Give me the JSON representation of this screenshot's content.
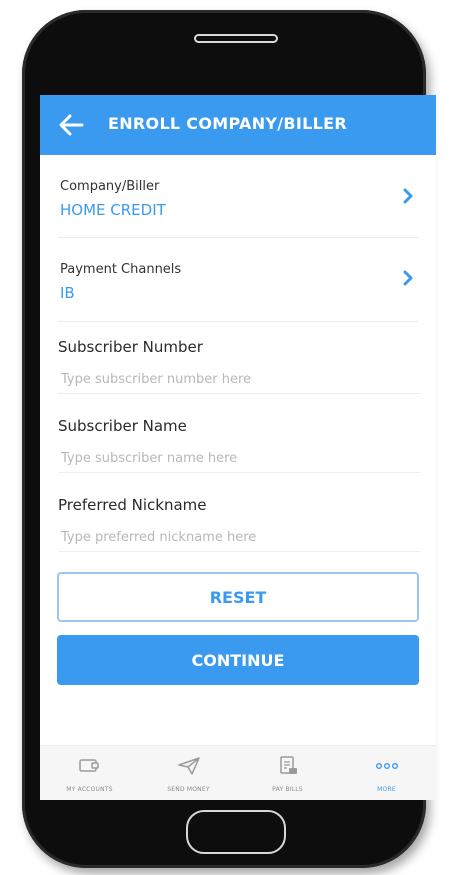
{
  "header": {
    "title": "ENROLL COMPANY/BILLER",
    "back_icon": "arrow-left-icon"
  },
  "form": {
    "company": {
      "label": "Company/Biller",
      "value": "HOME CREDIT"
    },
    "channels": {
      "label": "Payment Channels",
      "value": "IB"
    },
    "subscriber_number": {
      "label": "Subscriber Number",
      "placeholder": "Type subscriber number here",
      "value": ""
    },
    "subscriber_name": {
      "label": "Subscriber Name",
      "placeholder": "Type subscriber name here",
      "value": ""
    },
    "nickname": {
      "label": "Preferred Nickname",
      "placeholder": "Type preferred nickname here",
      "value": ""
    }
  },
  "buttons": {
    "reset": "RESET",
    "continue": "CONTINUE"
  },
  "tabs": [
    {
      "label": "MY ACCOUNTS",
      "icon": "wallet-icon",
      "active": false
    },
    {
      "label": "SEND MONEY",
      "icon": "paper-plane-icon",
      "active": false
    },
    {
      "label": "PAY BILLS",
      "icon": "bill-icon",
      "active": false
    },
    {
      "label": "MORE",
      "icon": "more-dots-icon",
      "active": true
    }
  ],
  "colors": {
    "accent": "#3a9af0",
    "tab_inactive": "#8a8a8a"
  }
}
